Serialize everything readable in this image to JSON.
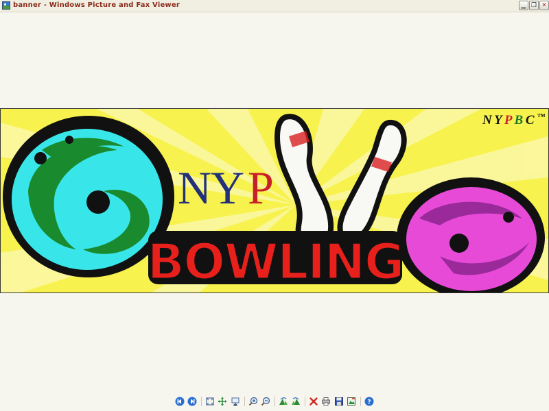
{
  "window": {
    "title": "banner - Windows Picture and Fax Viewer",
    "app_icon": "picture-viewer-icon",
    "controls": {
      "minimize_icon": "minimize-icon",
      "maximize_icon": "maximize-icon",
      "close_icon": "close-icon"
    }
  },
  "banner": {
    "logo_letters": [
      "N",
      "Y",
      "P"
    ],
    "word": "BOWLING",
    "trademark": {
      "letters": [
        "N",
        "Y",
        "P",
        "B",
        "C"
      ],
      "mark": "™"
    },
    "colors": {
      "background": "#f7f24e",
      "ball_left": "#38e6ea",
      "ball_left_swirl": "#1a8a2e",
      "ball_right": "#e84ad8",
      "ball_right_swirl": "#9a2a9a",
      "text": "#e8201c",
      "logo_blue": "#23307a",
      "logo_red": "#c8202a"
    }
  },
  "toolbar": {
    "buttons": [
      {
        "name": "previous-image",
        "icon": "previous-icon"
      },
      {
        "name": "next-image",
        "icon": "next-icon"
      },
      {
        "name": "best-fit",
        "icon": "best-fit-icon"
      },
      {
        "name": "actual-size",
        "icon": "actual-size-icon"
      },
      {
        "name": "slide-show",
        "icon": "slideshow-icon"
      },
      {
        "name": "zoom-in",
        "icon": "zoom-in-icon"
      },
      {
        "name": "zoom-out",
        "icon": "zoom-out-icon"
      },
      {
        "name": "rotate-clockwise",
        "icon": "rotate-clockwise-icon"
      },
      {
        "name": "rotate-counterclockwise",
        "icon": "rotate-counterclockwise-icon"
      },
      {
        "name": "delete",
        "icon": "delete-icon"
      },
      {
        "name": "print",
        "icon": "print-icon"
      },
      {
        "name": "save",
        "icon": "save-icon"
      },
      {
        "name": "edit",
        "icon": "edit-icon"
      },
      {
        "name": "help",
        "icon": "help-icon"
      }
    ]
  }
}
